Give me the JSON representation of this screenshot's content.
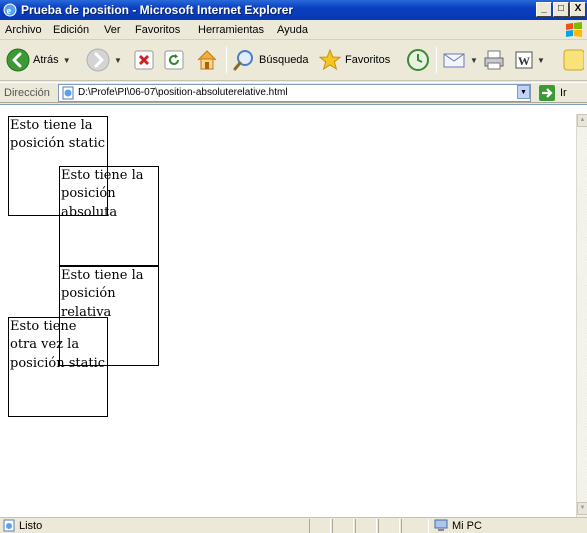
{
  "window": {
    "title": "Prueba de position - Microsoft Internet Explorer",
    "minimize": "_",
    "maximize": "□",
    "close": "X"
  },
  "menu": {
    "items": [
      "Archivo",
      "Edición",
      "Ver",
      "Favoritos",
      "Herramientas",
      "Ayuda"
    ],
    "underline": [
      "A",
      "E",
      "V",
      "F",
      "H",
      "u"
    ]
  },
  "toolbar": {
    "back_label": "Atrás",
    "search_label": "Búsqueda",
    "favorites_label": "Favoritos"
  },
  "address": {
    "label": "Dirección",
    "url": "D:\\Profe\\PI\\06-07\\position-absoluterelative.html",
    "go_label": "Ir"
  },
  "page": {
    "boxes": [
      {
        "name": "static-box-1",
        "text": "Esto tiene la posición static"
      },
      {
        "name": "absolute-box",
        "text": "Esto tiene la posición absoluta"
      },
      {
        "name": "relative-box",
        "text": "Esto tiene la posición relativa"
      },
      {
        "name": "static-box-2",
        "text": "Esto tiene otra vez la posición static"
      }
    ]
  },
  "status": {
    "text": "Listo",
    "zone": "Mi PC"
  },
  "colors": {
    "titlebar": "#0a3fc0",
    "chrome": "#ece9d8",
    "content_bg": "#ffffff"
  }
}
